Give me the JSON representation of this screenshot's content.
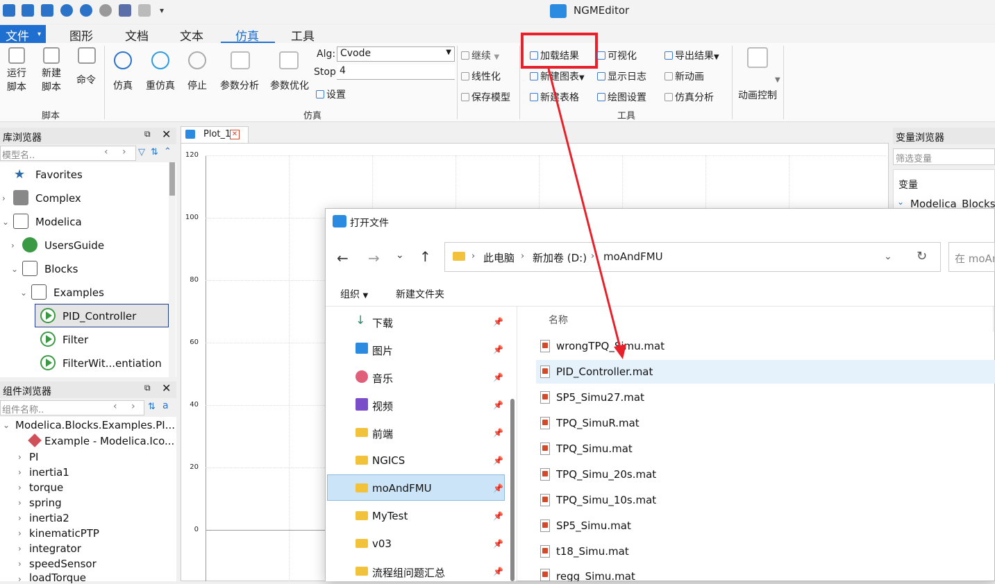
{
  "app": {
    "title": "NGMEditor"
  },
  "menu": [
    "文件",
    "图形",
    "文档",
    "文本",
    "仿真",
    "工具"
  ],
  "ribbon": {
    "script_group": {
      "label": "脚本",
      "run": "运行\n脚本",
      "new": "新建\n脚本",
      "cmd": "命令"
    },
    "sim_group": {
      "label": "仿真",
      "simulate": "仿真",
      "resim": "重仿真",
      "stop": "停止",
      "param_analysis": "参数分析",
      "param_opt": "参数优化",
      "alg_label": "Alg:",
      "alg_value": "Cvode",
      "stop_label": "Stop:",
      "stop_value": "4",
      "settings": "设置"
    },
    "mid": {
      "continue": "继续",
      "linearize": "线性化",
      "save_model": "保存模型"
    },
    "tools_group": {
      "label": "工具",
      "load_results": "加载结果",
      "visualize": "可视化",
      "export_results": "导出结果",
      "new_chart": "新建图表",
      "show_log": "显示日志",
      "new_anim": "新动画",
      "new_table": "新建表格",
      "plot_settings": "绘图设置",
      "sim_analysis": "仿真分析"
    },
    "anim": {
      "label": "动画控制"
    }
  },
  "lib_browser": {
    "title": "库浏览器",
    "search_placeholder": "模型名..",
    "items": [
      "Favorites",
      "Complex",
      "Modelica",
      "UsersGuide",
      "Blocks",
      "Examples",
      "PID_Controller",
      "Filter",
      "FilterWit...entiation"
    ]
  },
  "comp_browser": {
    "title": "组件浏览器",
    "search_placeholder": "组件名称..",
    "root": "Modelica.Blocks.Examples.PI...",
    "items": [
      "Example - Modelica.Ico...",
      "PI",
      "inertia1",
      "torque",
      "spring",
      "inertia2",
      "kinematicPTP",
      "integrator",
      "speedSensor",
      "loadTorque"
    ]
  },
  "plot": {
    "tab": "Plot_1",
    "yticks": [
      "120",
      "100",
      "80",
      "60",
      "40",
      "20",
      "0"
    ]
  },
  "var_browser": {
    "title": "变量浏览器",
    "filter_placeholder": "筛选变量",
    "header": "变量",
    "item": "Modelica_Blocks_E"
  },
  "dialog": {
    "title": "打开文件",
    "breadcrumb": [
      "此电脑",
      "新加卷 (D:)",
      "moAndFMU"
    ],
    "search_placeholder": "在 moAn",
    "organize": "组织",
    "new_folder": "新建文件夹",
    "col_name": "名称",
    "nav": [
      "下载",
      "图片",
      "音乐",
      "视频",
      "前端",
      "NGICS",
      "moAndFMU",
      "MyTest",
      "v03",
      "流程组问题汇总"
    ],
    "files": [
      "wrongTPQ_Simu.mat",
      "PID_Controller.mat",
      "SP5_Simu27.mat",
      "TPQ_SimuR.mat",
      "TPQ_Simu.mat",
      "TPQ_Simu_20s.mat",
      "TPQ_Simu_10s.mat",
      "SP5_Simu.mat",
      "t18_Simu.mat",
      "regg_Simu.mat"
    ]
  },
  "colors": {
    "accent": "#2b73c9",
    "highlight_box": "#e8202a",
    "selected_row": "#dcecfb",
    "menu_active": "#1e6fd0"
  }
}
